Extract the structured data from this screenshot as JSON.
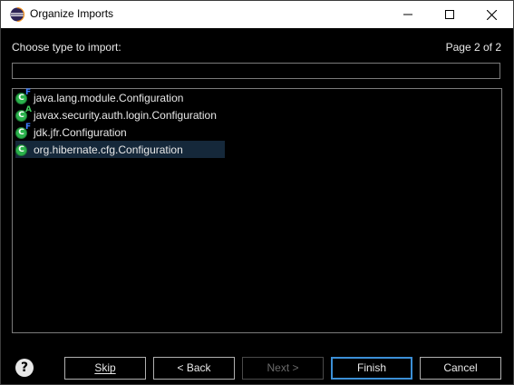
{
  "window": {
    "title": "Organize Imports"
  },
  "header": {
    "prompt": "Choose type to import:",
    "page_indicator": "Page 2 of 2"
  },
  "search": {
    "value": ""
  },
  "types": [
    {
      "name": "java.lang.module.Configuration",
      "modifier": "F",
      "selected": false
    },
    {
      "name": "javax.security.auth.login.Configuration",
      "modifier": "A",
      "selected": false
    },
    {
      "name": "jdk.jfr.Configuration",
      "modifier": "F",
      "selected": false
    },
    {
      "name": "org.hibernate.cfg.Configuration",
      "modifier": "",
      "selected": true
    }
  ],
  "buttons": {
    "skip": "Skip",
    "back": "< Back",
    "next": "Next >",
    "finish": "Finish",
    "cancel": "Cancel"
  },
  "help_glyph": "?",
  "icons": {
    "app": "eclipse-icon",
    "minimize": "minimize-icon",
    "maximize": "maximize-icon",
    "close": "close-icon",
    "help": "help-icon",
    "class": "class-icon"
  },
  "colors": {
    "background": "#000000",
    "selection": "#15283a",
    "class_icon": "#2bb24c",
    "final_modifier": "#3c7dff",
    "abstract_modifier": "#3cc85a",
    "default_button_border": "#3b8fd6"
  }
}
